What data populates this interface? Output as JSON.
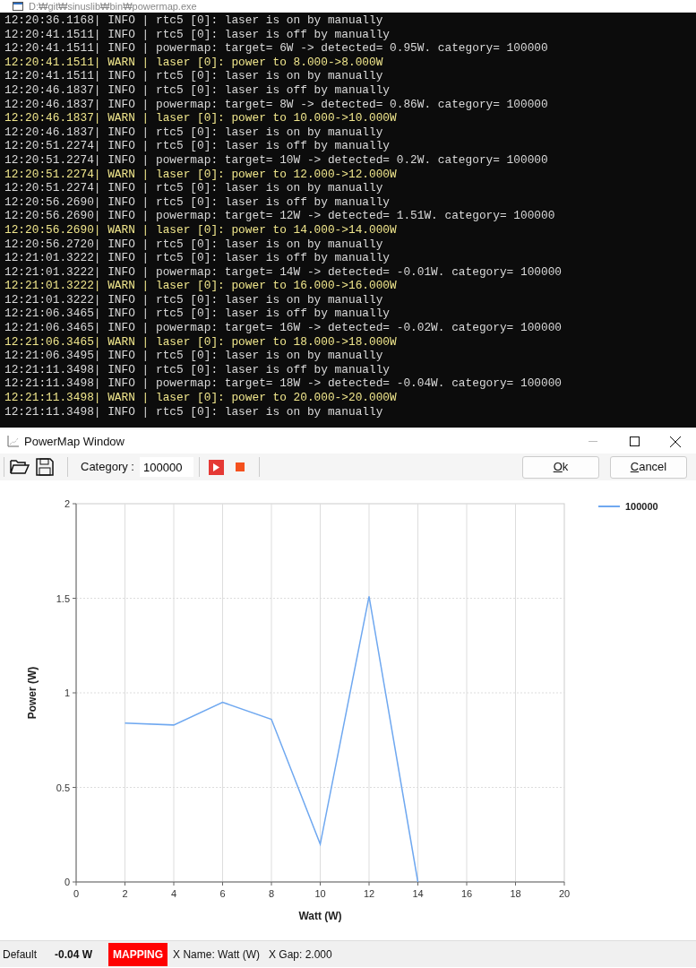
{
  "console": {
    "title": "D:₩git₩sinuslib₩bin₩powermap.exe",
    "lines": [
      {
        "kind": "info",
        "text": "12:20:36.1168| INFO | rtc5 [0]: laser is on by manually"
      },
      {
        "kind": "info",
        "text": "12:20:41.1511| INFO | rtc5 [0]: laser is off by manually"
      },
      {
        "kind": "info",
        "text": "12:20:41.1511| INFO | powermap: target= 6W -> detected= 0.95W. category= 100000"
      },
      {
        "kind": "warn",
        "text": "12:20:41.1511| WARN | laser [0]: power to 8.000->8.000W"
      },
      {
        "kind": "info",
        "text": "12:20:41.1511| INFO | rtc5 [0]: laser is on by manually"
      },
      {
        "kind": "info",
        "text": "12:20:46.1837| INFO | rtc5 [0]: laser is off by manually"
      },
      {
        "kind": "info",
        "text": "12:20:46.1837| INFO | powermap: target= 8W -> detected= 0.86W. category= 100000"
      },
      {
        "kind": "warn",
        "text": "12:20:46.1837| WARN | laser [0]: power to 10.000->10.000W"
      },
      {
        "kind": "info",
        "text": "12:20:46.1837| INFO | rtc5 [0]: laser is on by manually"
      },
      {
        "kind": "info",
        "text": "12:20:51.2274| INFO | rtc5 [0]: laser is off by manually"
      },
      {
        "kind": "info",
        "text": "12:20:51.2274| INFO | powermap: target= 10W -> detected= 0.2W. category= 100000"
      },
      {
        "kind": "warn",
        "text": "12:20:51.2274| WARN | laser [0]: power to 12.000->12.000W"
      },
      {
        "kind": "info",
        "text": "12:20:51.2274| INFO | rtc5 [0]: laser is on by manually"
      },
      {
        "kind": "info",
        "text": "12:20:56.2690| INFO | rtc5 [0]: laser is off by manually"
      },
      {
        "kind": "info",
        "text": "12:20:56.2690| INFO | powermap: target= 12W -> detected= 1.51W. category= 100000"
      },
      {
        "kind": "warn",
        "text": "12:20:56.2690| WARN | laser [0]: power to 14.000->14.000W"
      },
      {
        "kind": "info",
        "text": "12:20:56.2720| INFO | rtc5 [0]: laser is on by manually"
      },
      {
        "kind": "info",
        "text": "12:21:01.3222| INFO | rtc5 [0]: laser is off by manually"
      },
      {
        "kind": "info",
        "text": "12:21:01.3222| INFO | powermap: target= 14W -> detected= -0.01W. category= 100000"
      },
      {
        "kind": "warn",
        "text": "12:21:01.3222| WARN | laser [0]: power to 16.000->16.000W"
      },
      {
        "kind": "info",
        "text": "12:21:01.3222| INFO | rtc5 [0]: laser is on by manually"
      },
      {
        "kind": "info",
        "text": "12:21:06.3465| INFO | rtc5 [0]: laser is off by manually"
      },
      {
        "kind": "info",
        "text": "12:21:06.3465| INFO | powermap: target= 16W -> detected= -0.02W. category= 100000"
      },
      {
        "kind": "warn",
        "text": "12:21:06.3465| WARN | laser [0]: power to 18.000->18.000W"
      },
      {
        "kind": "info",
        "text": "12:21:06.3495| INFO | rtc5 [0]: laser is on by manually"
      },
      {
        "kind": "info",
        "text": "12:21:11.3498| INFO | rtc5 [0]: laser is off by manually"
      },
      {
        "kind": "info",
        "text": "12:21:11.3498| INFO | powermap: target= 18W -> detected= -0.04W. category= 100000"
      },
      {
        "kind": "warn",
        "text": "12:21:11.3498| WARN | laser [0]: power to 20.000->20.000W"
      },
      {
        "kind": "info",
        "text": "12:21:11.3498| INFO | rtc5 [0]: laser is on by manually"
      }
    ]
  },
  "window": {
    "title": "PowerMap Window"
  },
  "toolbar": {
    "category_label": "Category :",
    "category_value": "100000",
    "buttons": [
      "Ok",
      "Cancel"
    ]
  },
  "chart_data": {
    "type": "line",
    "xlabel": "Watt (W)",
    "ylabel": "Power (W)",
    "xlim": [
      0,
      20
    ],
    "ylim": [
      0,
      2
    ],
    "xticks": [
      0,
      2,
      4,
      6,
      8,
      10,
      12,
      14,
      16,
      18,
      20
    ],
    "yticks": [
      0,
      0.5,
      1,
      1.5,
      2
    ],
    "grid": true,
    "x": [
      2,
      4,
      6,
      8,
      10,
      12,
      14
    ],
    "series": [
      {
        "name": "100000",
        "color": "#6fa8f0",
        "values": [
          0.84,
          0.83,
          0.95,
          0.86,
          0.2,
          1.51,
          0
        ]
      }
    ]
  },
  "status_bar": {
    "mode": "Default",
    "value": "-0.04 W",
    "state": "MAPPING",
    "x_name": "X Name: Watt (W)",
    "x_gap": "X Gap: 2.000"
  }
}
